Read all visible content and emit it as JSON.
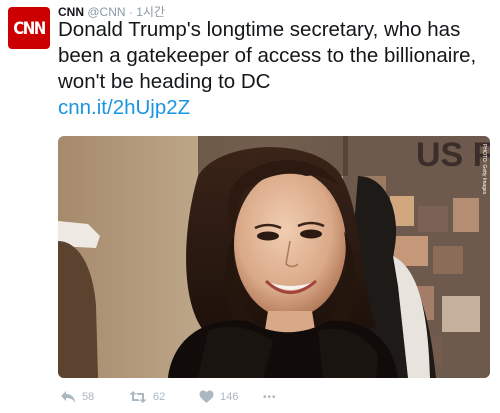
{
  "author": {
    "avatar_text": "CNN",
    "name": "CNN",
    "handle": "@CNN",
    "separator": "·",
    "time": "1시간"
  },
  "tweet": {
    "text": "Donald Trump's longtime secretary, who has been a gatekeeper of access to the billionaire, won't be heading to DC",
    "link": "cnn.it/2hUjp2Z"
  },
  "media": {
    "background_sign_text": "US F",
    "photo_credit": "PHOTO: Getty Images"
  },
  "actions": {
    "reply_count": "58",
    "retweet_count": "62",
    "like_count": "146",
    "more_glyph": "•••"
  },
  "colors": {
    "brand": "#cc0000",
    "link": "#1b95e0",
    "muted": "#8899a6",
    "action": "#aab8c2"
  }
}
